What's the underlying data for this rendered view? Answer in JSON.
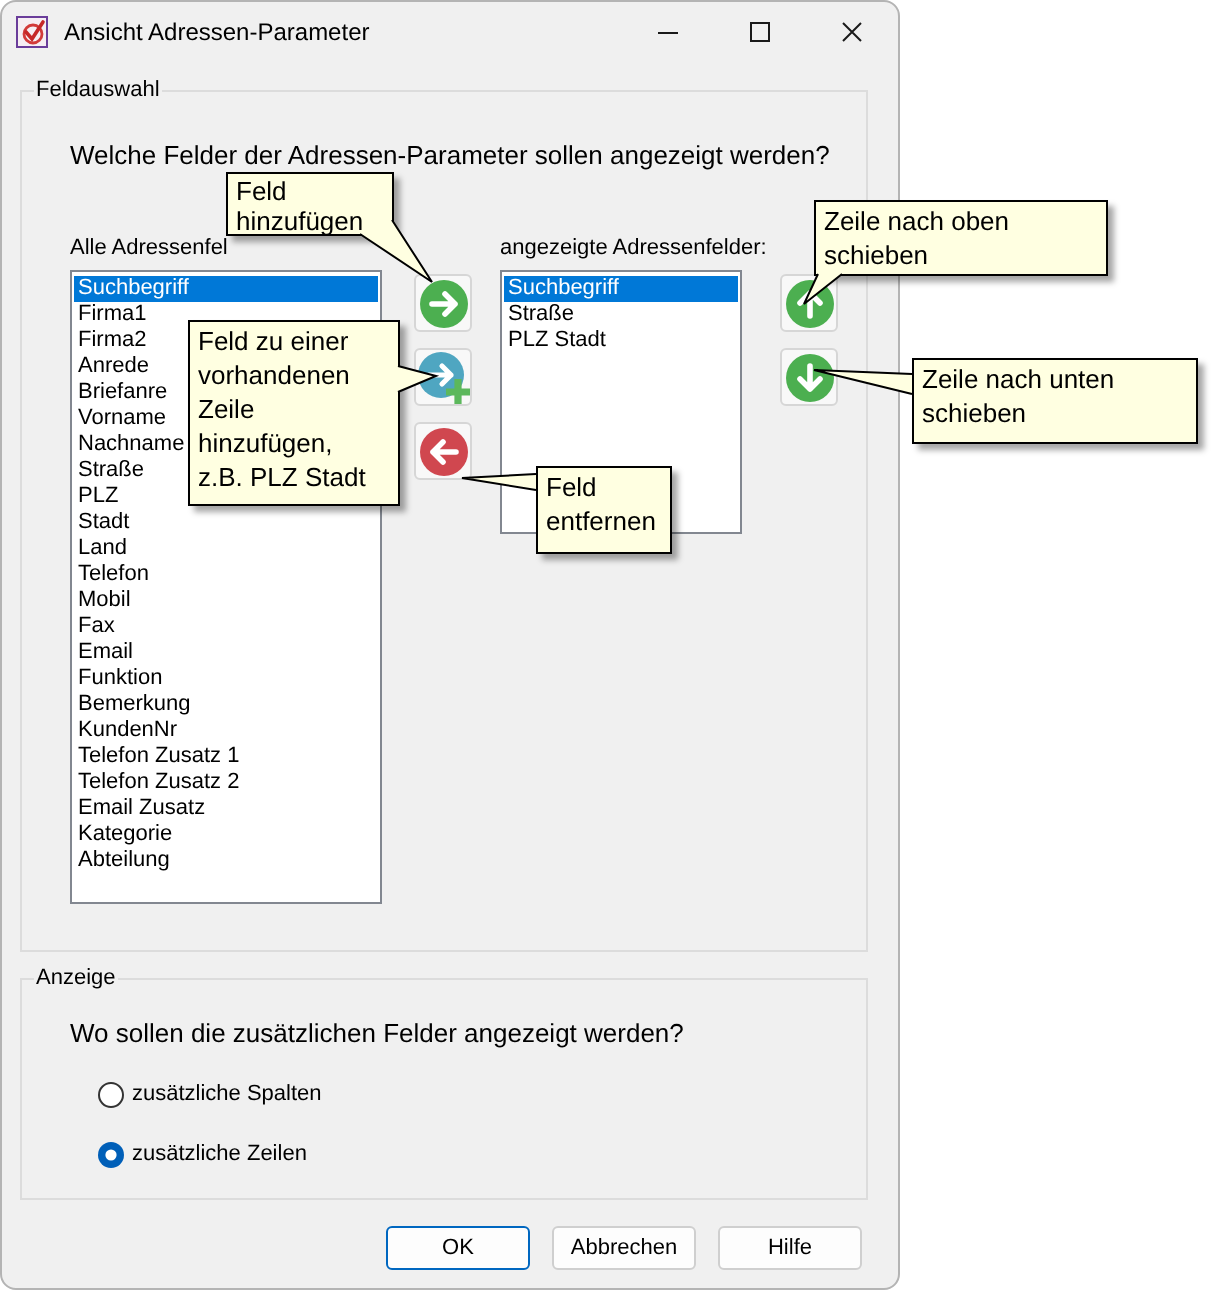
{
  "window": {
    "title": "Ansicht Adressen-Parameter"
  },
  "field_selection": {
    "legend": "Feldauswahl",
    "question": "Welche Felder der Adressen-Parameter sollen angezeigt werden?",
    "all_fields": {
      "label": "Alle Adressenfel",
      "items": [
        {
          "text": "Suchbegriff",
          "selected": true
        },
        {
          "text": "Firma1",
          "selected": false
        },
        {
          "text": "Firma2",
          "selected": false
        },
        {
          "text": "Anrede",
          "selected": false
        },
        {
          "text": "Briefanre",
          "selected": false
        },
        {
          "text": "Vorname",
          "selected": false
        },
        {
          "text": "Nachname",
          "selected": false
        },
        {
          "text": "Straße",
          "selected": false
        },
        {
          "text": "PLZ",
          "selected": false
        },
        {
          "text": "Stadt",
          "selected": false
        },
        {
          "text": "Land",
          "selected": false
        },
        {
          "text": "Telefon",
          "selected": false
        },
        {
          "text": "Mobil",
          "selected": false
        },
        {
          "text": "Fax",
          "selected": false
        },
        {
          "text": "Email",
          "selected": false
        },
        {
          "text": "Funktion",
          "selected": false
        },
        {
          "text": "Bemerkung",
          "selected": false
        },
        {
          "text": "KundenNr",
          "selected": false
        },
        {
          "text": "Telefon Zusatz 1",
          "selected": false
        },
        {
          "text": "Telefon Zusatz 2",
          "selected": false
        },
        {
          "text": "Email Zusatz",
          "selected": false
        },
        {
          "text": "Kategorie",
          "selected": false
        },
        {
          "text": "Abteilung",
          "selected": false
        }
      ]
    },
    "transfer_buttons": [
      {
        "kind": "add"
      },
      {
        "kind": "append"
      },
      {
        "kind": "remove"
      }
    ],
    "shown_fields": {
      "label": "angezeigte Adressenfelder:",
      "items": [
        {
          "text": "Suchbegriff",
          "selected": true
        },
        {
          "text": "Straße",
          "selected": false
        },
        {
          "text": "PLZ Stadt",
          "selected": false
        }
      ]
    },
    "order_buttons": [
      {
        "kind": "up"
      },
      {
        "kind": "down"
      }
    ]
  },
  "display": {
    "legend": "Anzeige",
    "question": "Wo sollen die zusätzlichen Felder angezeigt werden?",
    "options": [
      {
        "label": "zusätzliche Spalten",
        "selected": false
      },
      {
        "label": "zusätzliche Zeilen",
        "selected": true
      }
    ]
  },
  "buttons": [
    {
      "label": "OK",
      "default": true
    },
    {
      "label": "Abbrechen",
      "default": false
    },
    {
      "label": "Hilfe",
      "default": false
    }
  ],
  "callouts": [
    {
      "text": "Feld hinzufügen"
    },
    {
      "text": "Feld zu einer vorhandenen Zeile hinzufügen, z.B. PLZ Stadt"
    },
    {
      "text": "Feld entfernen"
    },
    {
      "text": "Zeile nach oben schieben"
    },
    {
      "text": "Zeile nach unten schieben"
    }
  ]
}
